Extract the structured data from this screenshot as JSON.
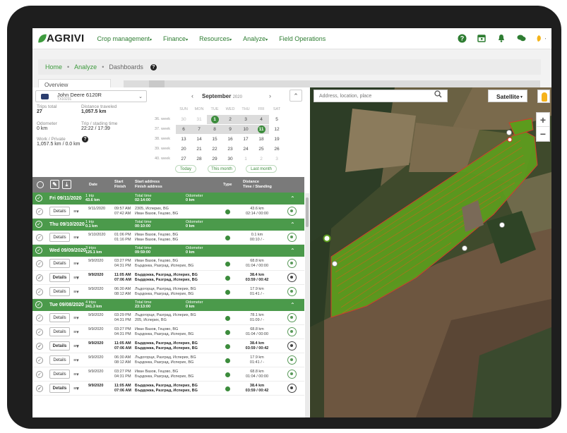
{
  "nav": {
    "brand": "AGRIVI",
    "menu": [
      {
        "label": "Crop management",
        "caret": "▾"
      },
      {
        "label": "Finance",
        "caret": "▾"
      },
      {
        "label": "Resources",
        "caret": "▾"
      },
      {
        "label": "Analyze",
        "caret": "▾"
      },
      {
        "label": "Field Operations",
        "caret": ""
      }
    ]
  },
  "breadcrumb": {
    "items": [
      "Home",
      "Analyze",
      "Dashboards"
    ],
    "help": "?"
  },
  "tabs": {
    "overview": "Overview"
  },
  "vehicle": {
    "name": "John Deere 6120R",
    "serial": "TX10231"
  },
  "stats": {
    "trips_total_label": "Trips total",
    "trips_total": "27",
    "distance_label": "Distance traveled",
    "distance": "1,057.5 km",
    "odometer_label": "Odometer",
    "odometer": "0 km",
    "trip_time_label": "Trip / stading time",
    "trip_time": "22:22 / 17:39",
    "work_private_label": "Work / Private",
    "work_private": "1,057.5 km / 0.0 km"
  },
  "calendar": {
    "month": "September",
    "year": "2020",
    "days": [
      "SUN",
      "MON",
      "TUE",
      "WED",
      "THU",
      "FRI",
      "SAT"
    ],
    "weeks": [
      {
        "label": "36. week",
        "d": [
          "30",
          "31",
          "1",
          "2",
          "3",
          "4",
          "5"
        ]
      },
      {
        "label": "37. week",
        "d": [
          "6",
          "7",
          "8",
          "9",
          "10",
          "11",
          "12"
        ]
      },
      {
        "label": "38. week",
        "d": [
          "13",
          "14",
          "15",
          "16",
          "17",
          "18",
          "19"
        ]
      },
      {
        "label": "39. week",
        "d": [
          "20",
          "21",
          "22",
          "23",
          "24",
          "25",
          "26"
        ]
      },
      {
        "label": "40. week",
        "d": [
          "27",
          "28",
          "29",
          "30",
          "1",
          "2",
          "3"
        ]
      }
    ],
    "buttons": {
      "today": "Today",
      "this_month": "This month",
      "last_month": "Last month"
    }
  },
  "table_headers": {
    "date": "Date",
    "start": "Start",
    "finish": "Finish",
    "start_address": "Start address",
    "finish_address": "Finish address",
    "type": "Type",
    "distance": "Distance",
    "time_standing": "Time / Standing"
  },
  "groups": [
    {
      "date": "Fri 09/11/2020",
      "trips": "1 trip",
      "dist": "43.6 km",
      "tt_label": "Total time",
      "tt": "02:14:00",
      "od_label": "Odometer",
      "od": "0 km",
      "rows": [
        {
          "date": "9/11/2020",
          "start": "09:57 AM",
          "finish": "07:42 AM",
          "a1": "2305, Исперих, BG",
          "a2": "Иван Вазов, Гецово, BG",
          "d1": "43.6 km",
          "d2": "02:14 / 00:00",
          "bold": false
        }
      ]
    },
    {
      "date": "Thu 09/10/2020",
      "trips": "1 trip",
      "dist": "0.1 km",
      "tt_label": "Total time",
      "tt": "00:10:00",
      "od_label": "Odometer",
      "od": "0 km",
      "rows": [
        {
          "date": "9/10/2020",
          "start": "01:06 PM",
          "finish": "01:16 PM",
          "a1": "Иван Вазов, Гецово, BG",
          "a2": "Иван Вазов, Гецово, BG",
          "d1": "0.1 km",
          "d2": "00:10 / -",
          "bold": false
        }
      ]
    },
    {
      "date": "Wed 09/09/2020",
      "trips": "3 trips",
      "dist": "125.1 km",
      "tt_label": "Total time",
      "tt": "09:59:00",
      "od_label": "Odometer",
      "od": "0 km",
      "rows": [
        {
          "date": "9/9/2020",
          "start": "03:27 PM",
          "finish": "04:31 PM",
          "a1": "Иван Вазов, Гецово, BG",
          "a2": "Бърдокка, Разград, Исперих, BG",
          "d1": "68.8 km",
          "d2": "01:04 / 00:00",
          "bold": false
        },
        {
          "date": "9/9/2020",
          "start": "11:05 AM",
          "finish": "07:06 AM",
          "a1": "Бърдокка, Разград, Исперих, BG",
          "a2": "Бърдокка, Разград, Исперих, BG",
          "d1": "38.4 km",
          "d2": "03:59 / 00:42",
          "bold": true
        },
        {
          "date": "9/9/2020",
          "start": "06:30 AM",
          "finish": "08:12 AM",
          "a1": "Лъдогорци, Разград, Исперих, BG",
          "a2": "Бърдокка, Разград, Исперих, BG",
          "d1": "17.9 km",
          "d2": "01:41 / -",
          "bold": false
        }
      ]
    },
    {
      "date": "Tue 09/08/2020",
      "trips": "4 trips",
      "dist": "241.3 km",
      "tt_label": "Total time",
      "tt": "23:13:00",
      "od_label": "Odometer",
      "od": "0 km",
      "rows": [
        {
          "date": "9/9/2020",
          "start": "03:29 PM",
          "finish": "04:31 PM",
          "a1": "Лъдогорци, Разград, Исперих, BG",
          "a2": "205, Исперих, BG",
          "d1": "78.1 km",
          "d2": "01:09 / -",
          "bold": false
        },
        {
          "date": "9/9/2020",
          "start": "03:27 PM",
          "finish": "04:31 PM",
          "a1": "Иван Вазов, Гецово, BG",
          "a2": "Бърдокка, Разград, Исперих, BG",
          "d1": "68.8 km",
          "d2": "01:04 / 00:00",
          "bold": false
        },
        {
          "date": "9/9/2020",
          "start": "11:05 AM",
          "finish": "07:06 AM",
          "a1": "Бърдокка, Разград, Исперих, BG",
          "a2": "Бърдокка, Разград, Исперих, BG",
          "d1": "38.4 km",
          "d2": "03:59 / 00:42",
          "bold": true
        },
        {
          "date": "9/9/2020",
          "start": "06:30 AM",
          "finish": "08:12 AM",
          "a1": "Лъдогорци, Разград, Исперих, BG",
          "a2": "Бърдокка, Разград, Исперих, BG",
          "d1": "17.9 km",
          "d2": "01:41 / -",
          "bold": false
        },
        {
          "date": "9/9/2020",
          "start": "03:27 PM",
          "finish": "04:31 PM",
          "a1": "Иван Вазов, Гецово, BG",
          "a2": "Бърдокка, Разград, Исперих, BG",
          "d1": "68.8 km",
          "d2": "01:04 / 00:00",
          "bold": false
        },
        {
          "date": "9/9/2020",
          "start": "11:05 AM",
          "finish": "07:06 AM",
          "a1": "Бърдокка, Разград, Исперих, BG",
          "a2": "Бърдокка, Разград, Исперих, BG",
          "d1": "38.4 km",
          "d2": "03:59 / 00:42",
          "bold": true
        }
      ]
    }
  ],
  "row_labels": {
    "details": "Details",
    "menu": "≡▾",
    "collapse": "⌃"
  },
  "map": {
    "search_placeholder": "Address, location, place",
    "map_type": "Satellite",
    "zoom_in": "+",
    "zoom_out": "−",
    "field_color": "#5a9a1e"
  }
}
